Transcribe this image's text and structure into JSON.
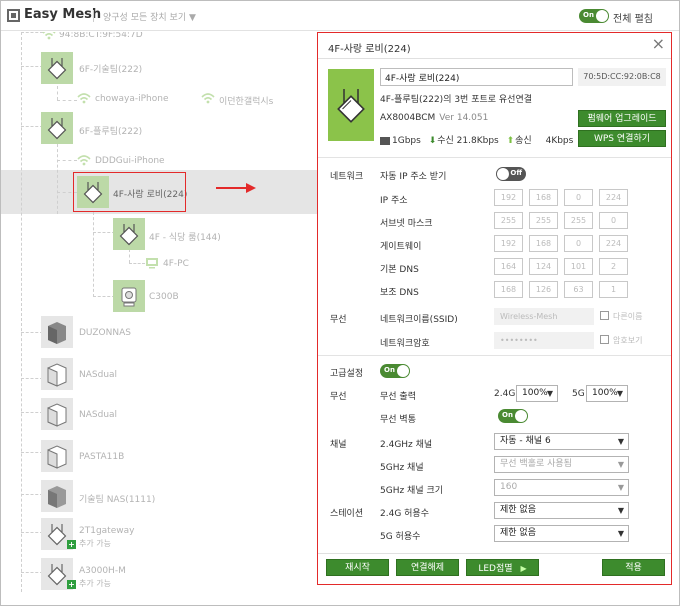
{
  "app": {
    "title": "Easy Mesh",
    "filter": "양구성 모든 장치 보기 ▼",
    "expand_label": "전체 펼침",
    "expand_toggle": "On"
  },
  "tree": {
    "nodes": [
      {
        "label": "94:8B:CT:9F:54:7D",
        "icon": "wifi-icon"
      },
      {
        "label": "6F-기술팀(222)",
        "icon": "router-icon"
      },
      {
        "label": "chowaya-iPhone",
        "icon": "wifi-icon"
      },
      {
        "label": "이던한갤럭시s",
        "icon": "wifi-icon"
      },
      {
        "label": "6F-플루팀(222)",
        "icon": "router-icon"
      },
      {
        "label": "DDDGui-iPhone",
        "icon": "wifi-icon"
      },
      {
        "label": "4F-사랑 로비(224)",
        "icon": "router-icon"
      },
      {
        "label": "4F - 식당 룸(144)",
        "icon": "router-icon"
      },
      {
        "label": "4F-PC",
        "icon": "pc-icon"
      },
      {
        "label": "C300B",
        "icon": "camera-icon"
      },
      {
        "label": "DUZONNAS",
        "icon": "nas-icon"
      },
      {
        "label": "NASdual",
        "icon": "nas-icon"
      },
      {
        "label": "NASdual",
        "icon": "nas-icon"
      },
      {
        "label": "PASTA11B",
        "icon": "nas-icon"
      },
      {
        "label": "기술팀 NAS(1111)",
        "icon": "nas-icon"
      },
      {
        "label": "2T1gateway",
        "sub": "추가 가능",
        "icon": "router-icon"
      },
      {
        "label": "A3000H-M",
        "sub": "추가 가능",
        "icon": "router-icon"
      }
    ]
  },
  "panel": {
    "title": "4F-사랑 로비(224)",
    "name_value": "4F-사랑 로비(224)",
    "mac": "70:5D:CC:92:0B:C8",
    "description": "4F-플루팀(222)의 3번 포트로 유선연결",
    "model": "AX8004BCM",
    "version": "Ver 14.051",
    "link_speed": "1Gbps",
    "rx": "수신 21.8Kbps",
    "tx": "송신",
    "tx_rate": "4Kbps",
    "firmware_button": "펌웨어 업그레이드",
    "wps_button": "WPS 연결하기",
    "network": {
      "section": "네트워크",
      "auto_ip_label": "자동 IP 주소 받기",
      "auto_ip_toggle": "Off",
      "ip_label": "IP 주소",
      "ip": [
        "192",
        "168",
        "0",
        "224"
      ],
      "subnet_label": "서브넷 마스크",
      "subnet": [
        "255",
        "255",
        "255",
        "0"
      ],
      "gateway_label": "게이트웨이",
      "gateway": [
        "192",
        "168",
        "0",
        "224"
      ],
      "dns1_label": "기본 DNS",
      "dns1": [
        "164",
        "124",
        "101",
        "2"
      ],
      "dns2_label": "보조 DNS",
      "dns2": [
        "168",
        "126",
        "63",
        "1"
      ]
    },
    "wireless": {
      "section": "무선",
      "ssid_label": "네트워크이름(SSID)",
      "ssid_value": "Wireless-Mesh",
      "ssid_check": "다른이름",
      "pw_label": "네트워크암호",
      "pw_value": "••••••••",
      "pw_check": "암호보기"
    },
    "advanced": {
      "section": "고급설정",
      "toggle": "On",
      "power_section": "무선",
      "power_label": "무선 출력",
      "band24": "2.4G",
      "power24": "100%",
      "band5": "5G",
      "power5": "100%",
      "wall_label": "무선 벽통",
      "wall_toggle": "On",
      "channel_section": "채널",
      "ch24_label": "2.4GHz 채널",
      "ch24_value": "자동 - 채널 6",
      "ch5_label": "5GHz 채널",
      "ch5_value": "무선 백홀로 사용됨",
      "ch5w_label": "5GHz 채널 크기",
      "ch5w_value": "160",
      "station_section": "스테이션",
      "st24_label": "2.4G 허용수",
      "st24_value": "제한 없음",
      "st5_label": "5G 허용수",
      "st5_value": "제한 없음"
    },
    "buttons": {
      "restart": "재시작",
      "disconnect": "연결해제",
      "led": "LED점멸",
      "apply": "적용"
    }
  },
  "colors": {
    "accent": "#3d8b2d",
    "highlight": "#e32a2a",
    "device": "#8bc34a"
  }
}
